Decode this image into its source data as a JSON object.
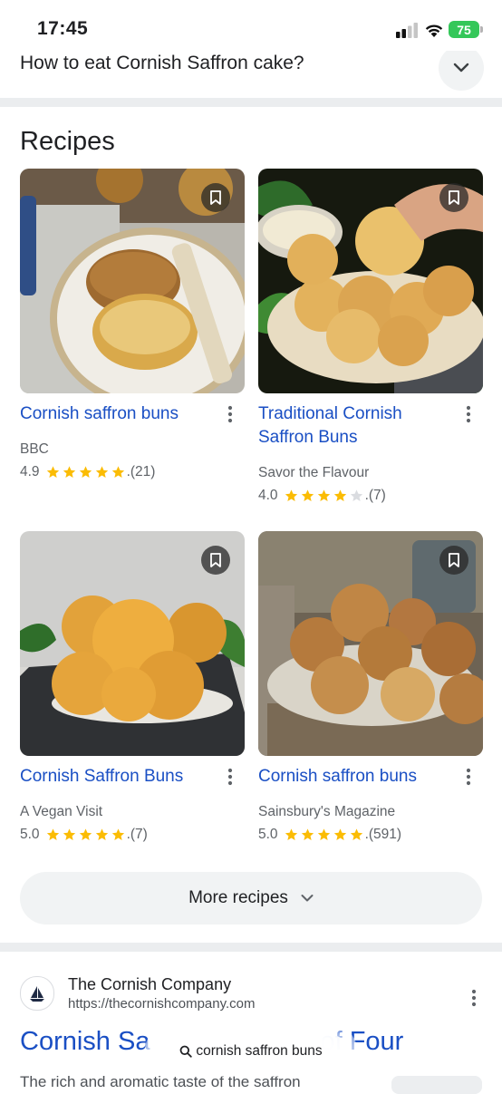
{
  "status_bar": {
    "time": "17:45",
    "battery": "75"
  },
  "faq": {
    "question": "How to eat Cornish Saffron cake?"
  },
  "recipes": {
    "title": "Recipes",
    "cards": [
      {
        "title": "Cornish saffron buns",
        "source": "BBC",
        "rating": "4.9",
        "stars": 5,
        "count": "(21)"
      },
      {
        "title": "Traditional Cornish Saffron Buns",
        "source": "Savor the Flavour",
        "rating": "4.0",
        "stars": 4,
        "count": "(7)"
      },
      {
        "title": "Cornish Saffron Buns",
        "source": "A Vegan Visit",
        "rating": "5.0",
        "stars": 5,
        "count": "(7)"
      },
      {
        "title": "Cornish saffron buns",
        "source": "Sainsbury's Magazine",
        "rating": "5.0",
        "stars": 5,
        "count": "(591)"
      }
    ],
    "more_label": "More recipes"
  },
  "result": {
    "site_name": "The Cornish Company",
    "url": "https://thecornishcompany.com",
    "title_start": "Cornish Sa",
    "title_end": "of Four",
    "snippet": "The rich and aromatic taste of the saffron"
  },
  "search_pill": {
    "query": "cornish saffron buns"
  },
  "icons": {
    "bookmark": "bookmark-icon",
    "more": "more-vert-icon",
    "chevron": "chevron-down-icon",
    "search": "search-icon"
  },
  "colors": {
    "link": "#1a4fc4",
    "star": "#fbbc04",
    "battery": "#34c759"
  }
}
